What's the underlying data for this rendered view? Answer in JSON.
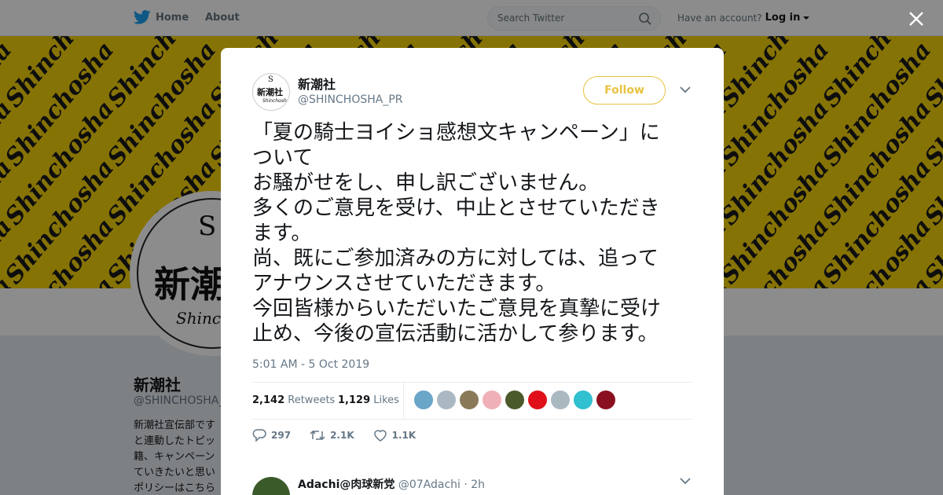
{
  "nav": {
    "home_label": "Home",
    "about_label": "About",
    "search_placeholder": "Search Twitter",
    "account_prompt": "Have an account?",
    "login_label": "Log in"
  },
  "banner": {
    "pattern_text": "Shinchosha",
    "background_color": "#f5d20a"
  },
  "profile": {
    "avatar_kanji": "新潮社",
    "avatar_letter": "S",
    "avatar_sub": "Shinchosha",
    "name": "新潮社",
    "handle": "@SHINCHOSHA_PR",
    "bio": "新潮社宣伝部です と連動したトピッ 籍、キャンペーン ていきたいと思い ポリシーはこちら"
  },
  "tweet": {
    "author_name": "新潮社",
    "author_handle": "@SHINCHOSHA_PR",
    "follow_label": "Follow",
    "text_lines": [
      "「夏の騎士ヨイショ感想文キャンペーン」に",
      "ついて",
      "お騒がせをし、申し訳ございません。",
      "多くのご意見を受け、中止とさせていただき",
      "ます。",
      "尚、既にご参加済みの方に対しては、追って",
      "アナウンスさせていただきます。",
      "今回皆様からいただいたご意見を真摯に受け",
      "止め、今後の宣伝活動に活かして参ります。"
    ],
    "timestamp": "5:01 AM - 5 Oct 2019",
    "retweets_count": "2,142",
    "retweets_label": "Retweets",
    "likes_count": "1,129",
    "likes_label": "Likes",
    "reply_action_count": "297",
    "retweet_action_count": "2.1K",
    "like_action_count": "1.1K",
    "liker_colors": [
      "#6aa6c8",
      "#aab8c2",
      "#8a7a5a",
      "#f0b0b8",
      "#4a5a2a",
      "#e0101a",
      "#aab8c2",
      "#30c0d0",
      "#8a1020"
    ]
  },
  "reply": {
    "name": "Adachi@肉球新党",
    "handle": "@07Adachi",
    "time": "· 2h"
  },
  "colors": {
    "accent": "#1da1f2",
    "follow": "#e8c341"
  }
}
